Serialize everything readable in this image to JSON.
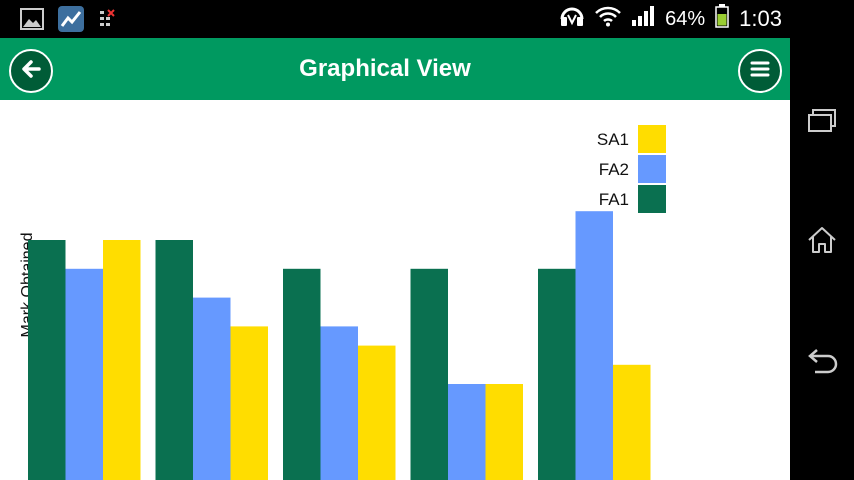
{
  "status_bar": {
    "battery_percent": "64%",
    "time": "1:03",
    "icons": [
      "gallery-icon",
      "chart-app-icon",
      "sim-icon",
      "headset-icon",
      "wifi-icon",
      "signal-icon",
      "battery-icon"
    ]
  },
  "app_bar": {
    "title": "Graphical View",
    "back_icon": "arrow-left-icon",
    "menu_icon": "hamburger-menu-icon"
  },
  "nav_bar": {
    "icons": [
      "recent-apps-icon",
      "home-icon",
      "back-icon"
    ]
  },
  "colors": {
    "app_bar": "#009960",
    "FA1": "#0a7050",
    "FA2": "#6699ff",
    "SA1": "#ffdd00"
  },
  "chart_data": {
    "type": "bar",
    "ylabel": "Mark Obtained",
    "xlabel": "",
    "categories": [
      "",
      "",
      "",
      "",
      ""
    ],
    "series": [
      {
        "name": "FA1",
        "values": [
          25,
          25,
          22,
          22,
          22
        ]
      },
      {
        "name": "FA2",
        "values": [
          22,
          19,
          16,
          10,
          28
        ]
      },
      {
        "name": "SA1",
        "values": [
          25,
          16,
          14,
          10,
          12
        ]
      }
    ],
    "legend_order": [
      "SA1",
      "FA2",
      "FA1"
    ],
    "legend_position": "top-right",
    "ylim": [
      0,
      50
    ],
    "grid": false
  }
}
